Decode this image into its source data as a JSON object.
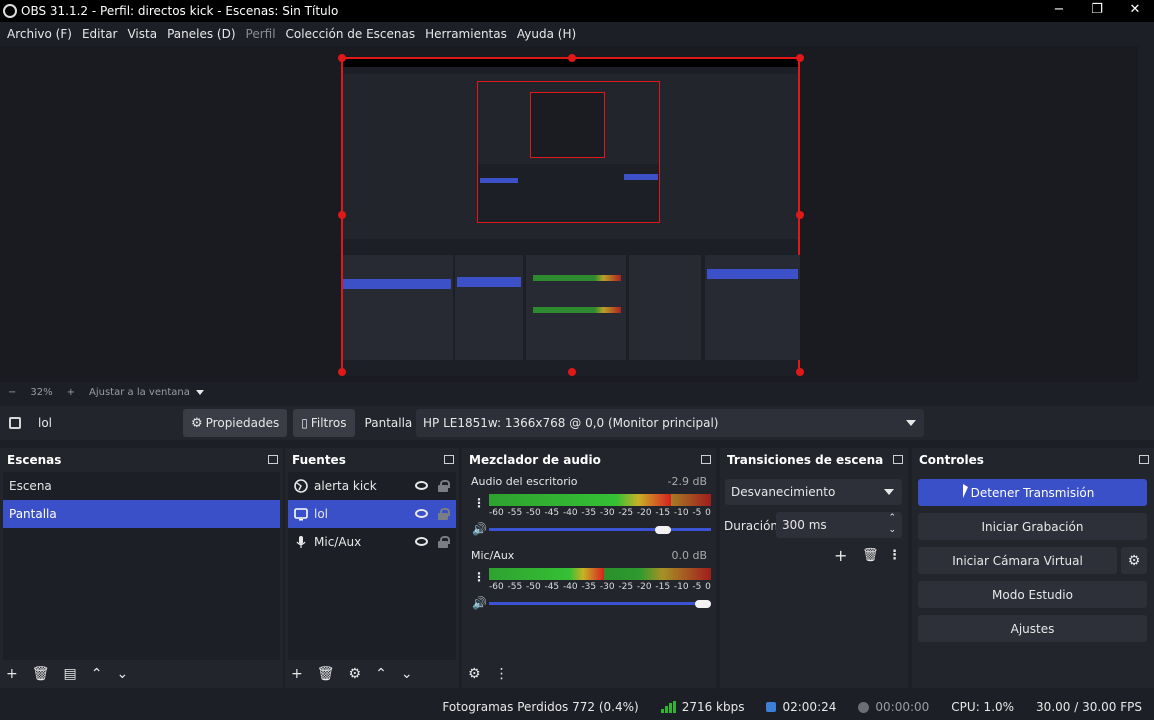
{
  "window": {
    "title": "OBS 31.1.2 - Perfil: directos kick - Escenas: Sin Título",
    "minimize": "−",
    "maximize": "❐",
    "close": "✕"
  },
  "menu": {
    "items": [
      "Archivo (F)",
      "Editar",
      "Vista",
      "Paneles (D)",
      "Perfil",
      "Colección de Escenas",
      "Herramientas",
      "Ayuda (H)"
    ]
  },
  "zoom": {
    "minus": "−",
    "level": "32%",
    "plus": "+",
    "fit": "Ajustar a la ventana"
  },
  "source_toolbar": {
    "source_name": "lol",
    "properties_label": "Propiedades",
    "filters_label": "Filtros",
    "display_label": "Pantalla",
    "display_value": "HP LE1851w: 1366x768 @ 0,0 (Monitor principal)"
  },
  "scenes": {
    "title": "Escenas",
    "items": [
      "Escena",
      "Pantalla"
    ],
    "selected": "Pantalla"
  },
  "sources": {
    "title": "Fuentes",
    "items": [
      {
        "label": "alerta kick",
        "icon": "browser-icon"
      },
      {
        "label": "lol",
        "icon": "monitor-icon"
      },
      {
        "label": "Mic/Aux",
        "icon": "microphone-icon"
      }
    ],
    "selected": "lol"
  },
  "mixer": {
    "title": "Mezclador de audio",
    "ticks": [
      "-60",
      "-55",
      "-50",
      "-45",
      "-40",
      "-35",
      "-30",
      "-25",
      "-20",
      "-15",
      "-10",
      "-5",
      "0"
    ],
    "channels": [
      {
        "name": "Audio del escritorio",
        "db": "-2.9 dB",
        "level": 0.82,
        "volume": 0.82
      },
      {
        "name": "Mic/Aux",
        "db": "0.0 dB",
        "level": 0.52,
        "volume": 1.0
      }
    ]
  },
  "transitions": {
    "title": "Transiciones de escena",
    "selected": "Desvanecimiento",
    "duration_label": "Duración",
    "duration_value": "300 ms"
  },
  "controls": {
    "title": "Controles",
    "stop_stream": "Detener Transmisión",
    "start_recording": "Iniciar Grabación",
    "start_virtualcam": "Iniciar Cámara Virtual",
    "studio_mode": "Modo Estudio",
    "settings": "Ajustes"
  },
  "status": {
    "dropped_frames": "Fotogramas Perdidos 772 (0.4%)",
    "bitrate": "2716 kbps",
    "stream_time": "02:00:24",
    "record_time": "00:00:00",
    "cpu": "CPU: 1.0%",
    "fps": "30.00 / 30.00 FPS"
  },
  "colors": {
    "accent": "#3a50c9",
    "selection_border": "#e01818",
    "background": "#1d1f26"
  }
}
